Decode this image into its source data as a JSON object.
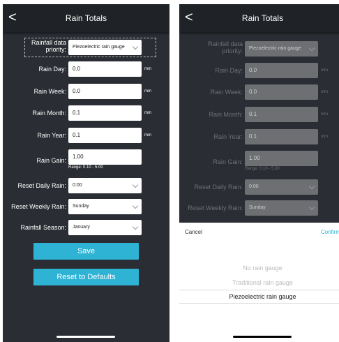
{
  "header": {
    "title": "Rain Totals",
    "back": "<"
  },
  "form": {
    "priority_label": "Rainfall data priority:",
    "priority_label_line1": "Rainfall data",
    "priority_label_line2": "priority:",
    "priority_value": "Piezoelectric rain gauge",
    "rain_day_label": "Rain Day:",
    "rain_day_value": "0.0",
    "rain_week_label": "Rain Week:",
    "rain_week_value": "0.0",
    "rain_month_label": "Rain Month:",
    "rain_month_value": "0.1",
    "rain_year_label": "Rain Year:",
    "rain_year_value": "0.1",
    "unit": "mm",
    "rain_gain_label": "Rain Gain:",
    "rain_gain_value": "1.00",
    "rain_gain_range": "Range: 0.10 - 5.00",
    "reset_daily_label": "Reset Daily Rain:",
    "reset_daily_value": "0:00",
    "reset_weekly_label": "Reset Weekly Rain:",
    "reset_weekly_value": "Sunday",
    "season_label": "Rainfall Season:",
    "season_value": "January"
  },
  "buttons": {
    "save": "Save",
    "reset": "Reset to Defaults"
  },
  "picker": {
    "cancel": "Cancel",
    "confirm": "Confirm",
    "options": [
      "No rain gauge",
      "Traditional rain gauge",
      "Piezoelectric rain gauge"
    ]
  },
  "colors": {
    "accent": "#2fb3d4",
    "background": "#2a2d33",
    "header": "#1f2226"
  }
}
